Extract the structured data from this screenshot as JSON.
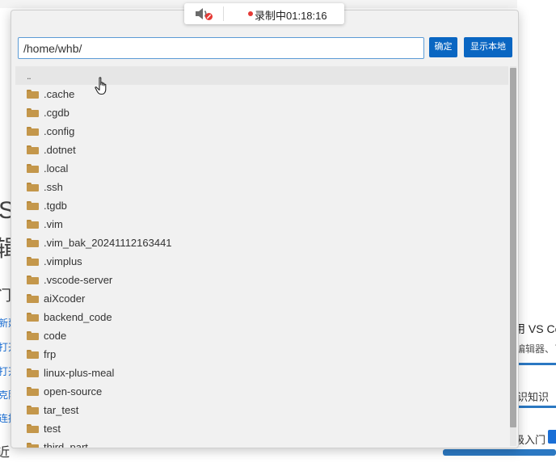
{
  "recording": {
    "status": "录制中01:18:16"
  },
  "dialog": {
    "path_value": "/home/whb/",
    "confirm_label": "确定",
    "show_local_label": "显示本地",
    "parent_entry": "..",
    "entries": [
      ".cache",
      ".cgdb",
      ".config",
      ".dotnet",
      ".local",
      ".ssh",
      ".tgdb",
      ".vim",
      ".vim_bak_20241112163441",
      ".vimplus",
      ".vscode-server",
      "aiXcoder",
      "backend_code",
      "code",
      "frp",
      "linux-plus-meal",
      "open-source",
      "tar_test",
      "test",
      "third_part"
    ],
    "folder_icon": "folder-icon",
    "colors": {
      "accent": "#0a66c2",
      "folder": "#c4974b",
      "dialog_bg": "#f1f1f1"
    }
  },
  "background": {
    "left_big_1": "S",
    "left_big_2": "辑",
    "left_small_1": "门",
    "left_link_1": "新建",
    "left_link_2": "打开",
    "left_link_3": "打开",
    "left_link_4": "克隆",
    "left_link_5": "连接",
    "left_bottom": "近",
    "card_title": "用 VS Code",
    "card_subtitle": "编辑器、了",
    "tab_label": "识知识",
    "entry_label": "级入门"
  }
}
